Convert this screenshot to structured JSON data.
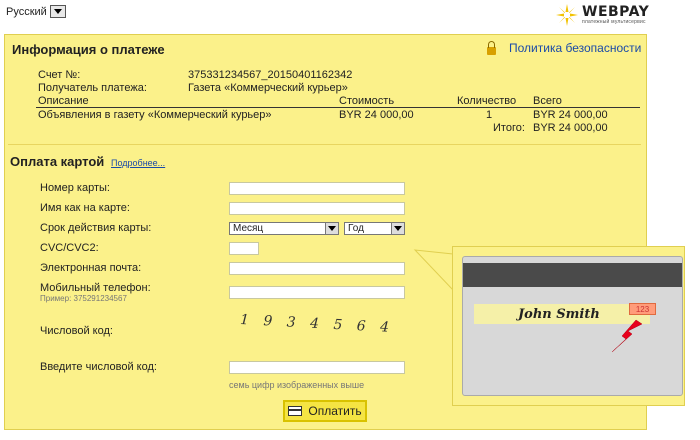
{
  "header": {
    "language": "Русский",
    "logo_text": "WEBPAY",
    "logo_subtitle": "платежный мультисервис"
  },
  "payment_info": {
    "title": "Информация о платеже",
    "policy_link": "Политика безопасности",
    "account_label": "Счет №:",
    "account_value": "375331234567_20150401162342",
    "recipient_label": "Получатель платежа:",
    "recipient_value": "Газета «Коммерческий курьер»",
    "columns": [
      "Описание",
      "Стоимость",
      "Количество",
      "Всего"
    ],
    "item": {
      "description": "Объявления в газету «Коммерческий курьер»",
      "price": "BYR 24 000,00",
      "quantity": "1",
      "total": "BYR 24 000,00"
    },
    "total_label": "Итого:",
    "total_value": "BYR 24 000,00"
  },
  "card_payment": {
    "title": "Оплата картой",
    "more_link": "Подробнее...",
    "fields": {
      "card_number": "Номер карты:",
      "name_on_card": "Имя как на карте:",
      "expiry": "Срок действия карты:",
      "cvc": "CVC/CVC2:",
      "email": "Электронная почта:",
      "phone": "Мобильный телефон:",
      "phone_example": "Пример: 375291234567",
      "captcha": "Числовой код:",
      "captcha_input": "Введите числовой код:",
      "captcha_hint": "семь цифр изображенных выше"
    },
    "month_select": "Месяц",
    "year_select": "Год",
    "captcha_digits": "1 9 3 4 5 6 4",
    "pay_button": "Оплатить"
  },
  "card_illustration": {
    "cardholder": "John Smith",
    "cvc_example": "123"
  },
  "colors": {
    "panel": "#fbf18a",
    "link": "#1a4aa8",
    "arrow": "#e8001c"
  }
}
